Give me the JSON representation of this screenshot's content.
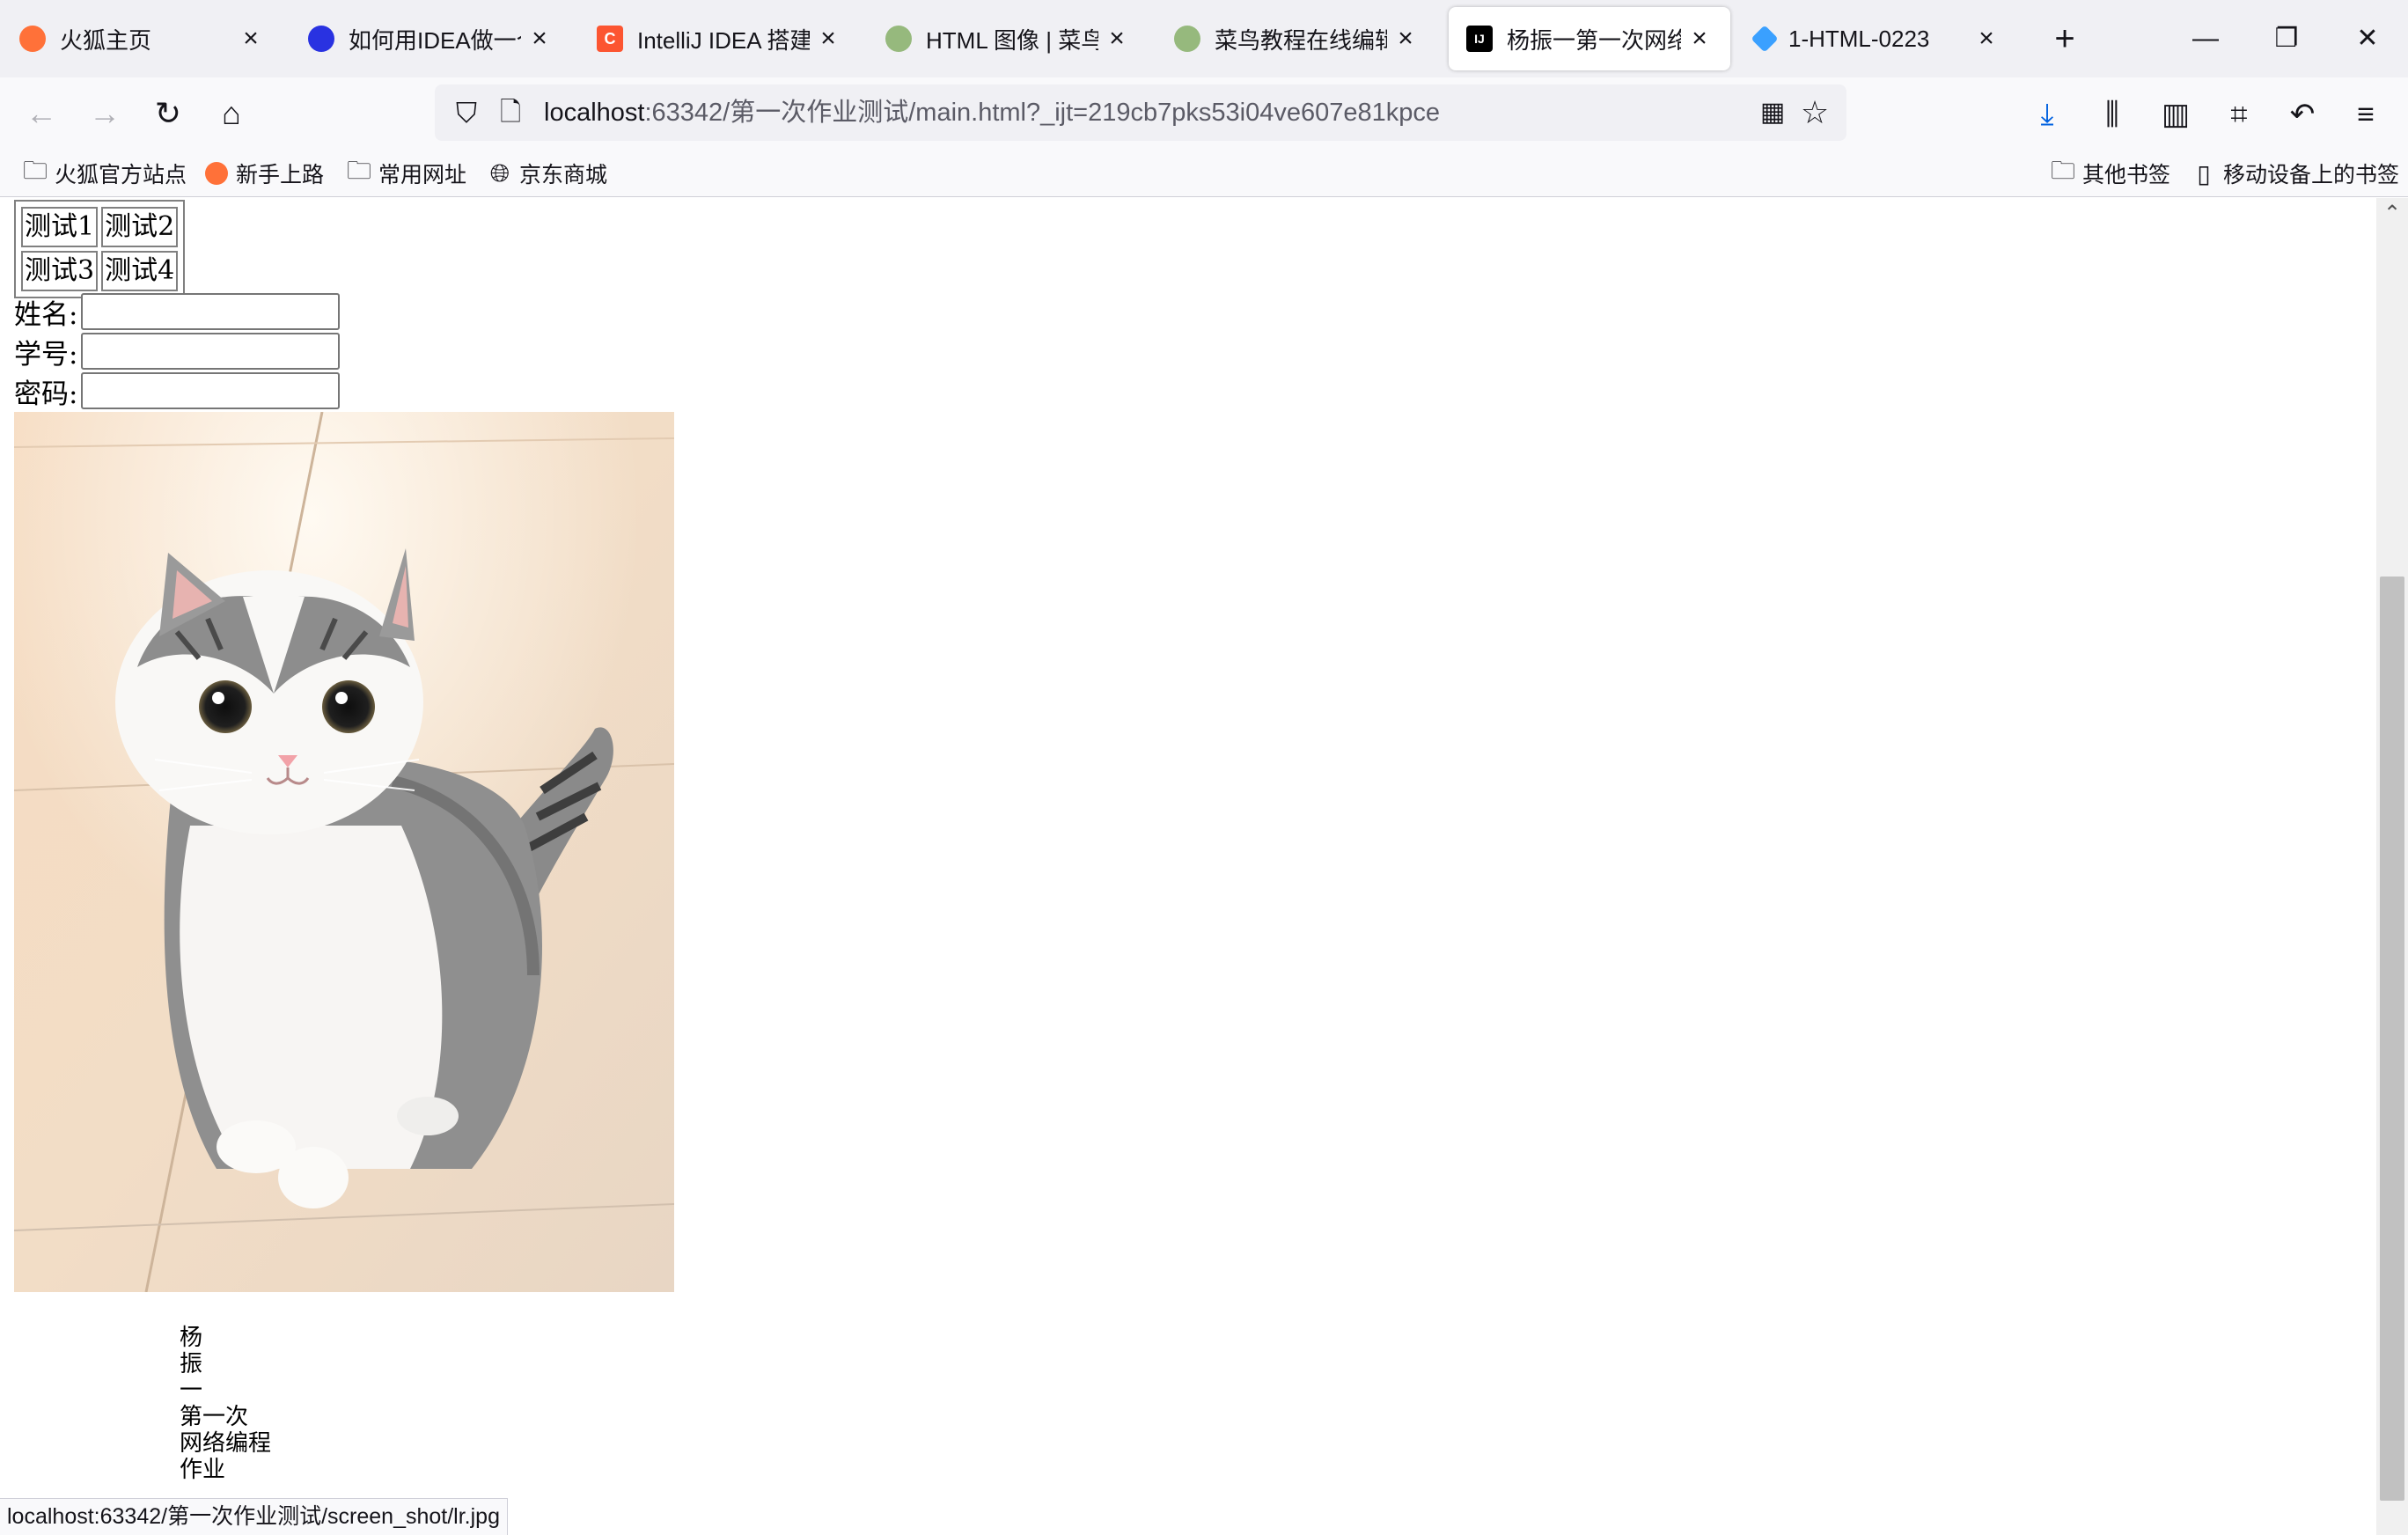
{
  "tabs": [
    {
      "title": "火狐主页",
      "icon": "firefox-icon",
      "color": "#ff7139",
      "glyph": ""
    },
    {
      "title": "如何用IDEA做一个网",
      "icon": "baidu-paw-icon",
      "color": "#2932e1",
      "glyph": ""
    },
    {
      "title": "IntelliJ IDEA 搭建一",
      "icon": "csdn-icon",
      "color": "#fc5531",
      "glyph": "C"
    },
    {
      "title": "HTML 图像 | 菜鸟教",
      "icon": "runoob-icon",
      "color": "#96b97d",
      "glyph": ""
    },
    {
      "title": "菜鸟教程在线编辑器",
      "icon": "runoob-icon",
      "color": "#96b97d",
      "glyph": ""
    },
    {
      "title": "杨振一第一次网络编",
      "icon": "intellij-icon",
      "color": "#000000",
      "glyph": "IJ",
      "active": true
    },
    {
      "title": "1-HTML-0223",
      "icon": "diamond-icon",
      "color": "#3aa0ff",
      "glyph": ""
    }
  ],
  "address": {
    "host": "localhost",
    "path": ":63342/第一次作业测试/main.html?_ijt=219cb7pks53i04ve607e81kpce"
  },
  "bookmarks": {
    "left": [
      {
        "label": "火狐官方站点",
        "icon": "folder-icon"
      },
      {
        "label": "新手上路",
        "icon": "firefox-icon"
      },
      {
        "label": "常用网址",
        "icon": "folder-icon"
      },
      {
        "label": "京东商城",
        "icon": "globe-icon"
      }
    ],
    "other": "其他书签",
    "mobile": "移动设备上的书签"
  },
  "page": {
    "table": [
      [
        "测试1",
        "测试2"
      ],
      [
        "测试3",
        "测试4"
      ]
    ],
    "form": {
      "name_label": "姓名:",
      "id_label": "学号:",
      "password_label": "密码:",
      "name_value": "",
      "id_value": "",
      "password_value": ""
    },
    "vertical_text": [
      "杨",
      "振",
      "一",
      "第一次",
      "网络编程",
      "作业"
    ]
  },
  "status_url": "localhost:63342/第一次作业测试/screen_shot/lr.jpg",
  "colors": {
    "tabbar_bg": "#f0f0f4",
    "toolbar_bg": "#f9f9fb",
    "download_accent": "#0061e0"
  }
}
